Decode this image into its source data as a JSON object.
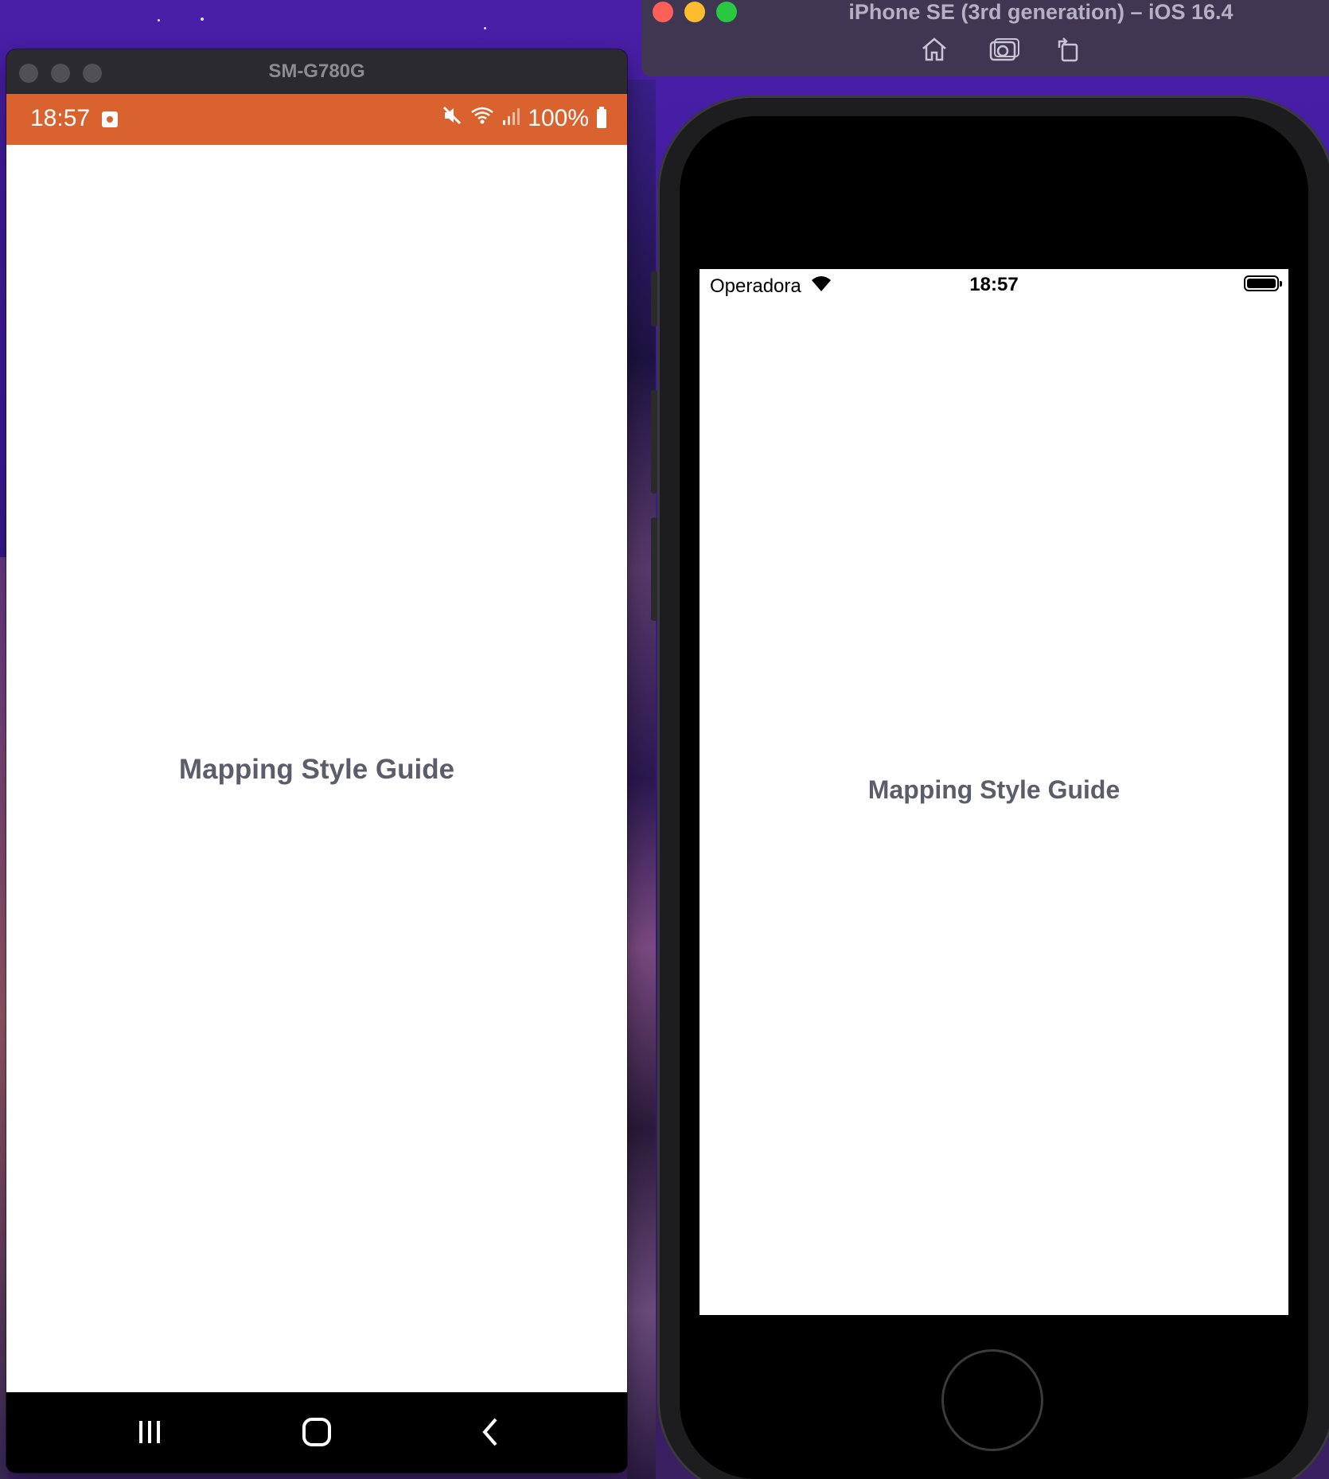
{
  "android": {
    "window_title": "SM-G780G",
    "status_time": "18:57",
    "battery_text": "100%",
    "app_title": "Mapping Style Guide",
    "status_bar_color": "#d9622f"
  },
  "ios": {
    "window_title": "iPhone SE (3rd generation) – iOS 16.4",
    "carrier": "Operadora",
    "status_time": "18:57",
    "app_title": "Mapping Style Guide",
    "toolbar_icons": [
      "home-icon",
      "screenshot-icon",
      "rotate-icon"
    ]
  },
  "colors": {
    "title_text": "#5b5d6a",
    "traffic_red": "#ff5f57",
    "traffic_yellow": "#febc2e",
    "traffic_green": "#28c840"
  }
}
